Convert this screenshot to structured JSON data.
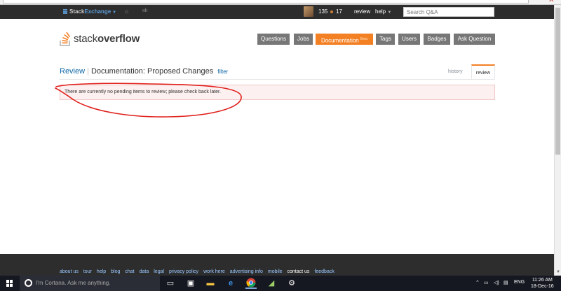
{
  "topbar": {
    "brand_stack": "Stack",
    "brand_exchange": "Exchange",
    "reputation": "135",
    "bronze_badges": "17",
    "review_label": "review",
    "help_label": "help",
    "search_placeholder": "Search Q&A"
  },
  "header": {
    "logo_light": "stack",
    "logo_bold": "overflow",
    "nav": [
      {
        "label": "Questions"
      },
      {
        "label": "Jobs"
      },
      {
        "label": "Documentation",
        "beta": "Beta"
      },
      {
        "label": "Tags"
      },
      {
        "label": "Users"
      },
      {
        "label": "Badges"
      },
      {
        "label": "Ask Question"
      }
    ]
  },
  "review": {
    "root_link": "Review",
    "queue_title": "Documentation: Proposed Changes",
    "filter_label": "filter",
    "tabs": [
      {
        "label": "history"
      },
      {
        "label": "review"
      }
    ],
    "notice": "There are currently no pending items to review; please check back later."
  },
  "footer": {
    "links": [
      "about us",
      "tour",
      "help",
      "blog",
      "chat",
      "data",
      "legal",
      "privacy policy",
      "work here",
      "advertising info",
      "mobile",
      "contact us",
      "feedback"
    ]
  },
  "taskbar": {
    "cortana_placeholder": "I'm Cortana. Ask me anything.",
    "language": "ENG",
    "time": "11:26 AM",
    "date": "18-Dec-16"
  },
  "colors": {
    "accent_orange": "#f48024",
    "nav_gray": "#777777",
    "topbar_dark": "#2d2d2d",
    "link_blue": "#0c65a5",
    "notice_bg": "#fdf0f0",
    "annotation_red": "#e0201b"
  }
}
